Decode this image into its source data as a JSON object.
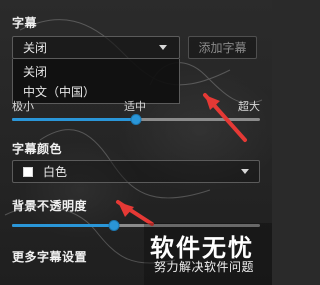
{
  "subtitles": {
    "section_title": "字幕",
    "dropdown_value": "关闭",
    "add_button_label": "添加字幕",
    "menu_items": [
      "关闭",
      "中文（中国）"
    ]
  },
  "size": {
    "labels": {
      "left": "极小",
      "middle": "适中",
      "right": "超大"
    },
    "value_fraction": 0.5
  },
  "color": {
    "section_title": "字幕颜色",
    "value_label": "白色",
    "swatch_color": "#ffffff"
  },
  "opacity": {
    "section_title": "背景不透明度",
    "value_fraction": 0.41
  },
  "more": {
    "label": "更多字幕设置"
  },
  "watermark": {
    "title": "软件无忧",
    "subtitle": "努力解决软件问题"
  },
  "colors": {
    "accent": "#2a96d8",
    "annotation_arrow": "#e53935"
  }
}
